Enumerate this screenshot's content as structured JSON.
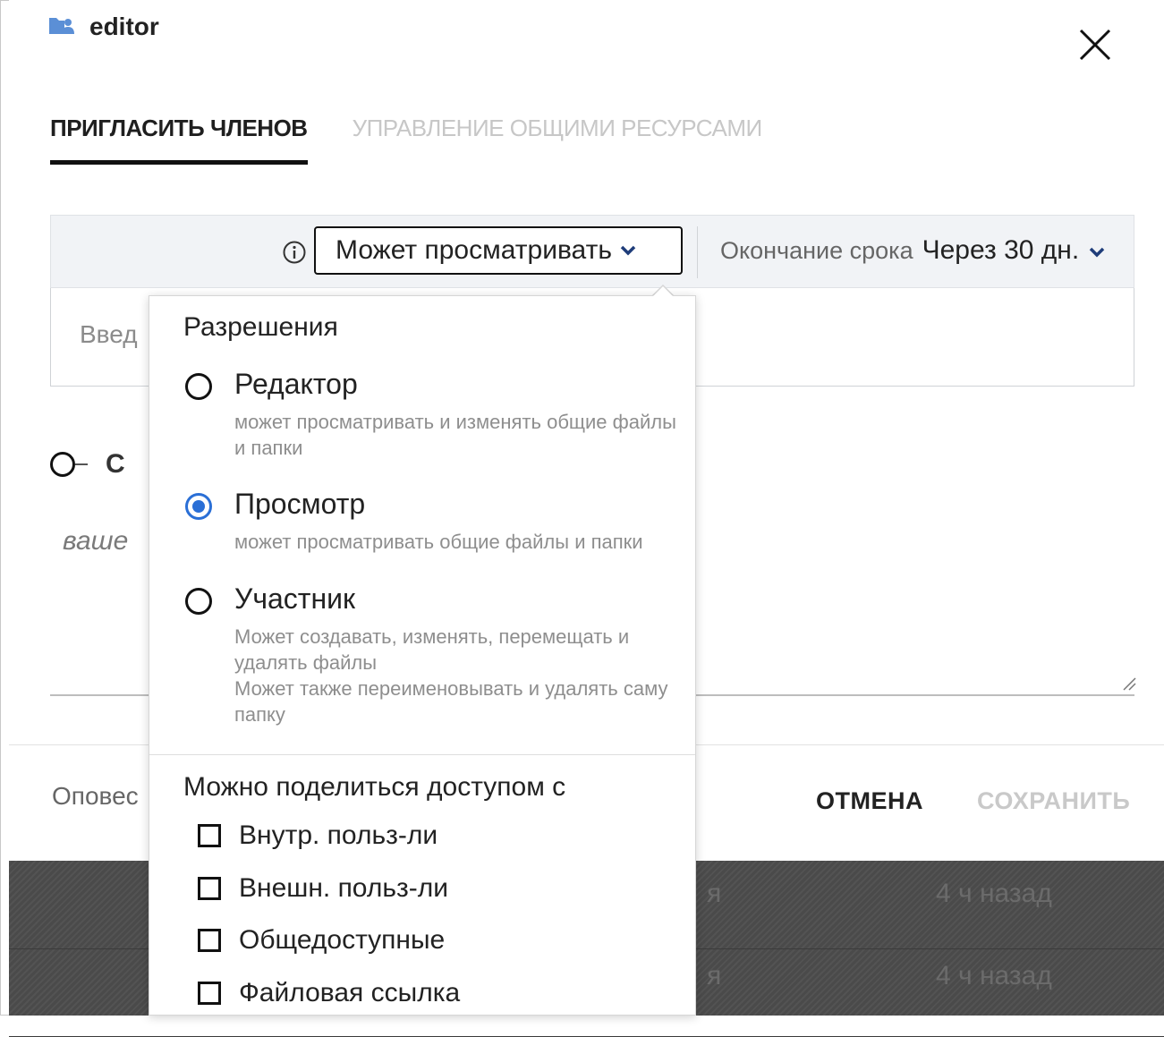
{
  "header": {
    "title": "editor",
    "icon": "shared-folder-icon"
  },
  "tabs": [
    {
      "label": "ПРИГЛАСИТЬ ЧЛЕНОВ",
      "active": true
    },
    {
      "label": "УПРАВЛЕНИЕ ОБЩИМИ РЕСУРСАМИ",
      "active": false
    }
  ],
  "permission_bar": {
    "selected_permission": "Может просматривать",
    "expiry_label": "Окончание срока",
    "expiry_value": "Через 30 дн."
  },
  "invite": {
    "placeholder_visible": "Введ"
  },
  "notify_toggle": {
    "label_visible": "С"
  },
  "message": {
    "placeholder_visible": "ваше"
  },
  "footer": {
    "notify_visible": "Оповес",
    "cancel_label": "ОТМЕНА",
    "save_label": "СОХРАНИТЬ"
  },
  "popup": {
    "permissions_title": "Разрешения",
    "options": [
      {
        "name": "Редактор",
        "description": "может просматривать и изменять общие файлы и папки",
        "checked": false
      },
      {
        "name": "Просмотр",
        "description": "может просматривать общие файлы и папки",
        "checked": true
      },
      {
        "name": "Участник",
        "description": "Может создавать, изменять, перемещать и удалять файлы",
        "description2": "Может также переименовывать и удалять саму папку",
        "checked": false
      }
    ],
    "share_title": "Можно поделиться доступом с",
    "share_options": [
      {
        "label": "Внутр. польз-ли",
        "checked": false
      },
      {
        "label": "Внешн. польз-ли",
        "checked": false
      },
      {
        "label": "Общедоступные",
        "checked": false
      },
      {
        "label": "Файловая ссылка",
        "checked": false
      }
    ]
  },
  "background_list": [
    {
      "who": "я",
      "when": "4 ч назад"
    },
    {
      "who": "я",
      "when": "4 ч назад"
    }
  ],
  "colors": {
    "accent": "#2a6fd6",
    "bar_bg": "#f1f3f6"
  }
}
